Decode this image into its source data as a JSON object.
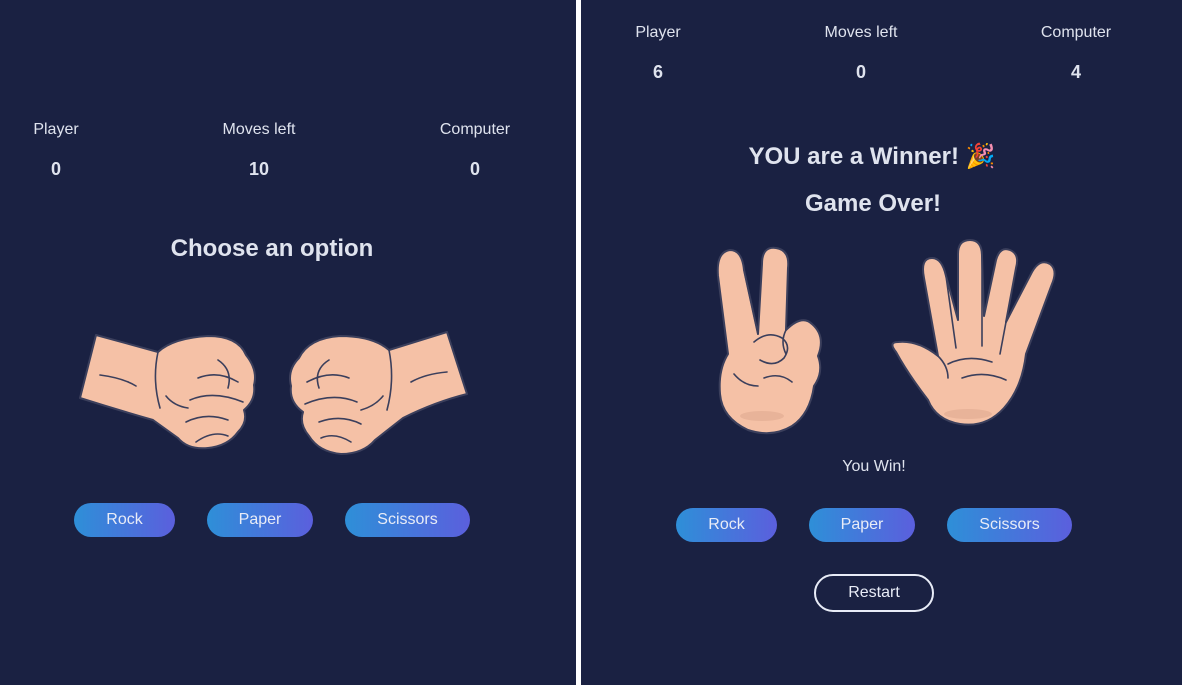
{
  "left_panel": {
    "scoreboard": {
      "player_label": "Player",
      "player_score": "0",
      "moves_label": "Moves left",
      "moves_value": "10",
      "computer_label": "Computer",
      "computer_score": "0"
    },
    "heading": "Choose an option",
    "player_hand": "rock-hand-icon",
    "computer_hand": "rock-hand-icon",
    "buttons": {
      "rock": "Rock",
      "paper": "Paper",
      "scissors": "Scissors"
    }
  },
  "right_panel": {
    "scoreboard": {
      "player_label": "Player",
      "player_score": "6",
      "moves_label": "Moves left",
      "moves_value": "0",
      "computer_label": "Computer",
      "computer_score": "4"
    },
    "winner_message": "YOU are a Winner! 🎉",
    "game_over": "Game Over!",
    "player_hand": "scissors-hand-icon",
    "computer_hand": "paper-hand-icon",
    "result": "You Win!",
    "buttons": {
      "rock": "Rock",
      "paper": "Paper",
      "scissors": "Scissors"
    },
    "restart": "Restart"
  },
  "colors": {
    "background": "#1a2142",
    "text": "#dfe3ee",
    "button_gradient_start": "#2e8fd8",
    "button_gradient_end": "#5b5fdd",
    "skin": "#f5c1a6",
    "divider": "#ffffff"
  }
}
